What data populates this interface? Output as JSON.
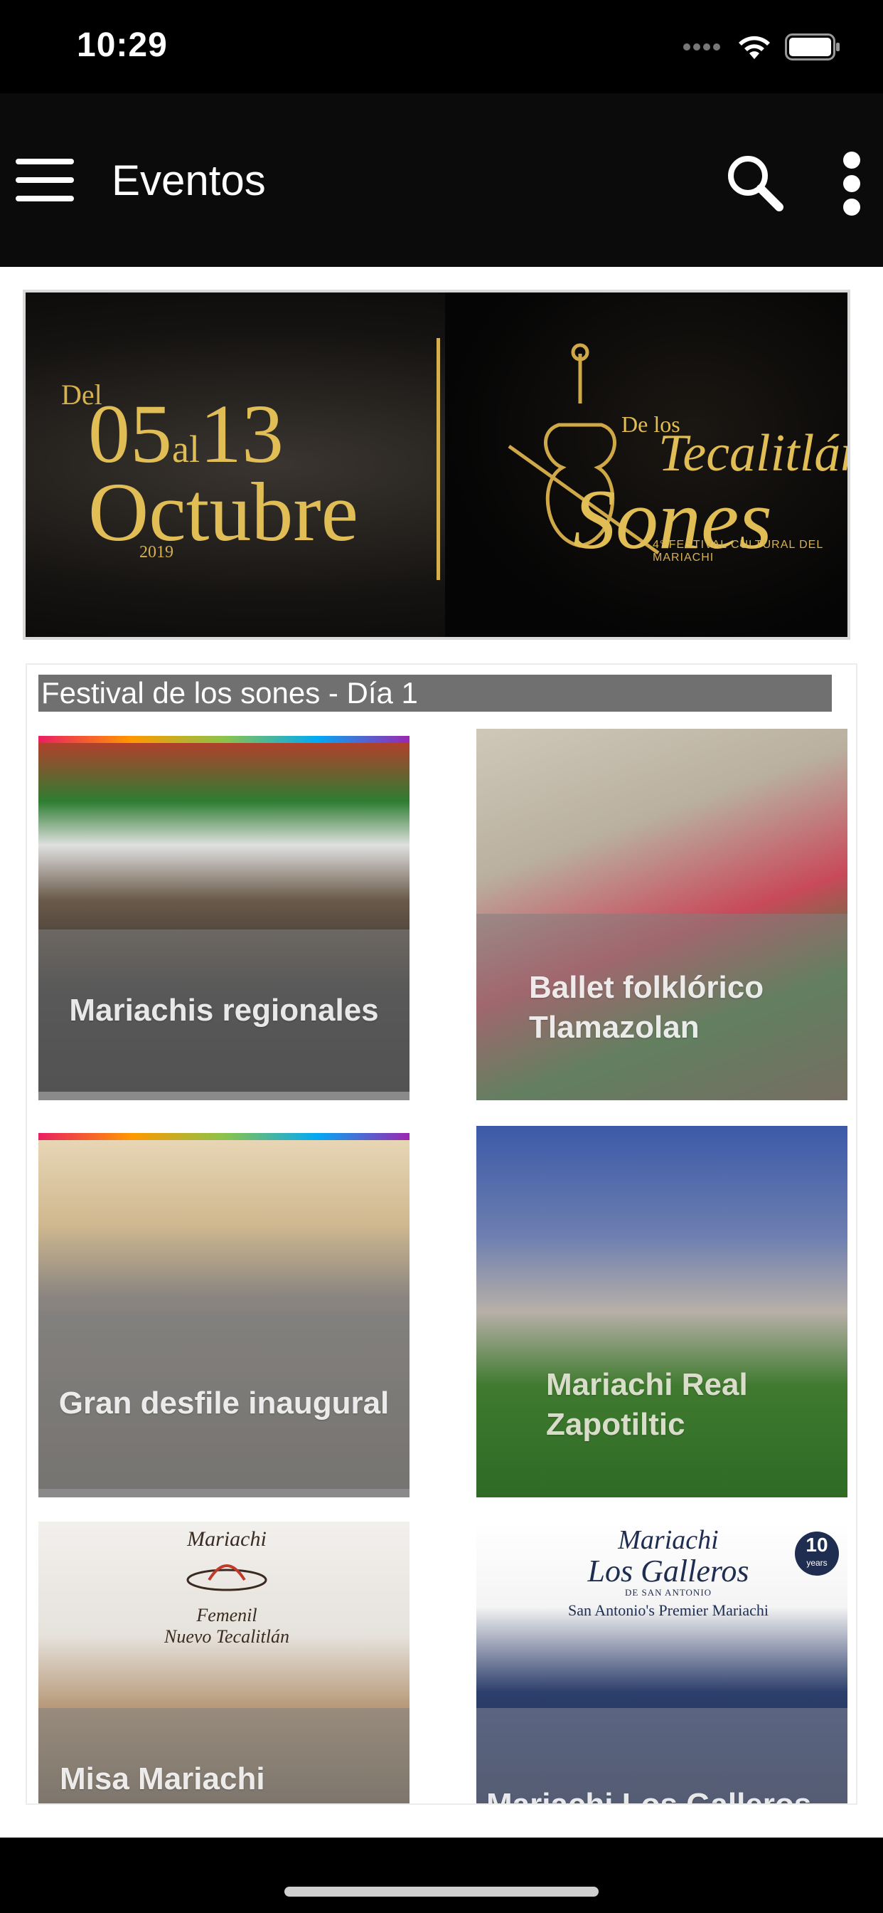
{
  "status_bar": {
    "time": "10:29"
  },
  "app_bar": {
    "title": "Eventos"
  },
  "banner": {
    "del": "Del",
    "date_from": "05",
    "al": "al",
    "date_to": "13",
    "month": "Octubre",
    "year": "2019",
    "de_los": "De los",
    "place": "Tecalitlán",
    "sones": "Sones",
    "festival": "4° FESTIVAL CULTURAL DEL MARIACHI"
  },
  "section": {
    "title": "Festival de los sones - Día 1",
    "events": [
      {
        "label": "Mariachis regionales"
      },
      {
        "label": "Ballet folklórico Tlamazolan"
      },
      {
        "label": "Gran desfile inaugural"
      },
      {
        "label": "Mariachi Real Zapotiltic"
      },
      {
        "label": "Misa Mariachi"
      },
      {
        "label": "Mariachi Los Galleros"
      }
    ]
  },
  "tile_art": {
    "misa_logo_top": "Mariachi",
    "misa_logo_line1": "Femenil",
    "misa_logo_line2": "Nuevo Tecalitlán",
    "galleros_logo_top": "Mariachi",
    "galleros_logo_main": "Los Galleros",
    "galleros_logo_sub": "DE SAN ANTONIO",
    "galleros_badge": "10",
    "galleros_badge_sub": "years",
    "galleros_tagline": "San Antonio's Premier Mariachi"
  }
}
